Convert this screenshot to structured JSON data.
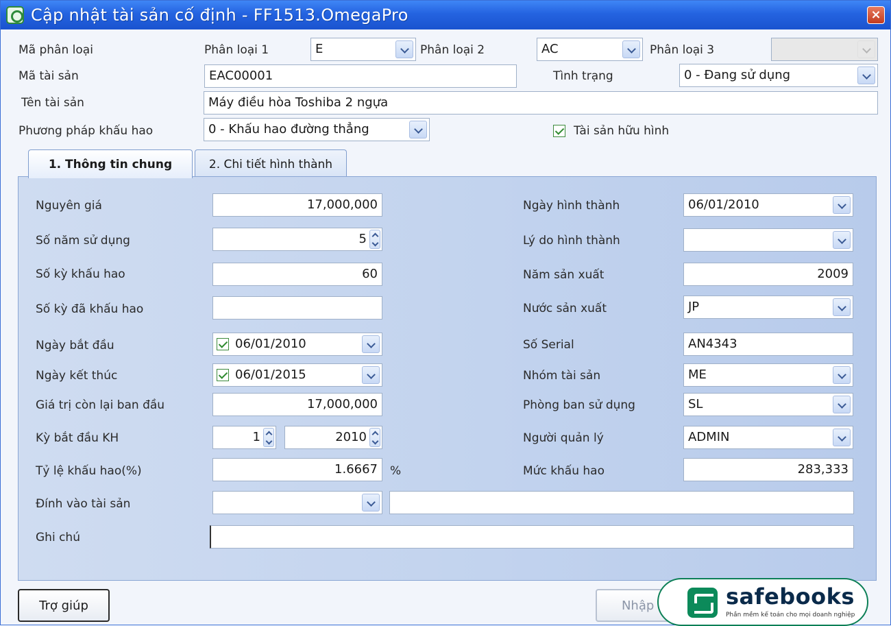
{
  "window": {
    "title": "Cập nhật tài sản cố định - FF1513.OmegaPro"
  },
  "header": {
    "ma_phan_loai_label": "Mã phân loại",
    "phan_loai_1_label": "Phân loại 1",
    "phan_loai_1_value": "E",
    "phan_loai_2_label": "Phân loại 2",
    "phan_loai_2_value": "AC",
    "phan_loai_3_label": "Phân loại 3",
    "phan_loai_3_value": "",
    "ma_tai_san_label": "Mã tài sản",
    "ma_tai_san_value": "EAC00001",
    "tinh_trang_label": "Tình trạng",
    "tinh_trang_value": "0 - Đang sử dụng",
    "ten_tai_san_label": "Tên tài sản",
    "ten_tai_san_value": "Máy điều hòa Toshiba 2 ngựa",
    "phuong_phap_label": "Phương pháp khấu hao",
    "phuong_phap_value": "0 - Khấu hao đường thẳng",
    "tai_san_huu_hinh_label": "Tài sản hữu hình",
    "tai_san_huu_hinh_checked": true
  },
  "tabs": [
    {
      "label": "1. Thông tin chung",
      "active": true
    },
    {
      "label": "2. Chi tiết hình thành",
      "active": false
    }
  ],
  "left": {
    "nguyen_gia_label": "Nguyên giá",
    "nguyen_gia_value": "17,000,000",
    "so_nam_label": "Số năm sử dụng",
    "so_nam_value": "5",
    "so_ky_label": "Số kỳ khấu hao",
    "so_ky_value": "60",
    "so_ky_da_label": "Số kỳ đã khấu hao",
    "so_ky_da_value": "",
    "ngay_bat_dau_label": "Ngày bắt đầu",
    "ngay_bat_dau_value": "06/01/2010",
    "ngay_ket_thuc_label": "Ngày kết thúc",
    "ngay_ket_thuc_value": "06/01/2015",
    "gia_tri_con_lai_label": "Giá trị còn lại ban đầu",
    "gia_tri_con_lai_value": "17,000,000",
    "ky_bat_dau_label": "Kỳ bắt đầu KH",
    "ky_bat_dau_period": "1",
    "ky_bat_dau_year": "2010",
    "ty_le_label": "Tỷ lệ khấu hao(%)",
    "ty_le_value": "1.6667",
    "ty_le_unit": "%",
    "dinh_vao_label": "Đính vào tài sản",
    "dinh_vao_value": "",
    "dinh_vao_name": "",
    "ghi_chu_label": "Ghi chú",
    "ghi_chu_value": ""
  },
  "right": {
    "ngay_hinh_thanh_label": "Ngày hình thành",
    "ngay_hinh_thanh_value": "06/01/2010",
    "ly_do_label": "Lý do hình thành",
    "ly_do_value": "",
    "nam_san_xuat_label": "Năm sản xuất",
    "nam_san_xuat_value": "2009",
    "nuoc_san_xuat_label": "Nước sản xuất",
    "nuoc_san_xuat_value": "JP",
    "so_serial_label": "Số Serial",
    "so_serial_value": "AN4343",
    "nhom_tai_san_label": "Nhóm tài sản",
    "nhom_tai_san_value": "ME",
    "phong_ban_label": "Phòng ban sử dụng",
    "phong_ban_value": "SL",
    "nguoi_quan_ly_label": "Người quản lý",
    "nguoi_quan_ly_value": "ADMIN",
    "muc_khau_hao_label": "Mức khấu hao",
    "muc_khau_hao_value": "283,333"
  },
  "footer": {
    "help_button": "Trợ giúp",
    "save_button": "Nhập lại"
  },
  "watermark": {
    "name": "safebooks",
    "tagline": "Phần mềm kế toán cho mọi doanh nghiệp",
    "brand_color": "#0c8a5a"
  }
}
